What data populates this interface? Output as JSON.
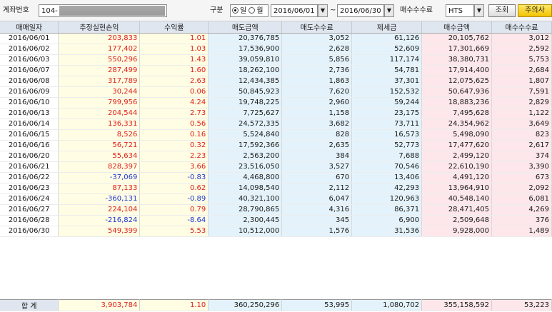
{
  "toolbar": {
    "account_label": "계좌번호",
    "account_value": "104-",
    "type_label": "구분",
    "radio_daily": "일",
    "radio_monthly": "월",
    "date_from": "2016/06/01",
    "date_tilde": "~",
    "date_to": "2016/06/30",
    "fee_label": "매수수수료",
    "fee_value": "HTS",
    "query_button": "조회",
    "notice_button": "주의사"
  },
  "table": {
    "headers": [
      "매매일자",
      "추정실현손익",
      "수익률",
      "매도금액",
      "매도수수료",
      "제세금",
      "매수금액",
      "매수수수료"
    ],
    "rows": [
      [
        "2016/06/01",
        "203,833",
        "1.01",
        "20,376,785",
        "3,052",
        "61,126",
        "20,105,762",
        "3,012"
      ],
      [
        "2016/06/02",
        "177,402",
        "1.03",
        "17,536,900",
        "2,628",
        "52,609",
        "17,301,669",
        "2,592"
      ],
      [
        "2016/06/03",
        "550,296",
        "1.43",
        "39,059,810",
        "5,856",
        "117,174",
        "38,380,731",
        "5,753"
      ],
      [
        "2016/06/07",
        "287,499",
        "1.60",
        "18,262,100",
        "2,736",
        "54,781",
        "17,914,400",
        "2,684"
      ],
      [
        "2016/06/08",
        "317,789",
        "2.63",
        "12,434,385",
        "1,863",
        "37,301",
        "12,075,625",
        "1,807"
      ],
      [
        "2016/06/09",
        "30,244",
        "0.06",
        "50,845,923",
        "7,620",
        "152,532",
        "50,647,936",
        "7,591"
      ],
      [
        "2016/06/10",
        "799,956",
        "4.24",
        "19,748,225",
        "2,960",
        "59,244",
        "18,883,236",
        "2,829"
      ],
      [
        "2016/06/13",
        "204,544",
        "2.73",
        "7,725,627",
        "1,158",
        "23,175",
        "7,495,628",
        "1,122"
      ],
      [
        "2016/06/14",
        "136,331",
        "0.56",
        "24,572,335",
        "3,682",
        "73,711",
        "24,354,962",
        "3,649"
      ],
      [
        "2016/06/15",
        "8,526",
        "0.16",
        "5,524,840",
        "828",
        "16,573",
        "5,498,090",
        "823"
      ],
      [
        "2016/06/16",
        "56,721",
        "0.32",
        "17,592,366",
        "2,635",
        "52,773",
        "17,477,620",
        "2,617"
      ],
      [
        "2016/06/20",
        "55,634",
        "2.23",
        "2,563,200",
        "384",
        "7,688",
        "2,499,120",
        "374"
      ],
      [
        "2016/06/21",
        "828,397",
        "3.66",
        "23,516,050",
        "3,527",
        "70,546",
        "22,610,190",
        "3,390"
      ],
      [
        "2016/06/22",
        "-37,069",
        "-0.83",
        "4,468,800",
        "670",
        "13,406",
        "4,491,120",
        "673"
      ],
      [
        "2016/06/23",
        "87,133",
        "0.62",
        "14,098,540",
        "2,112",
        "42,293",
        "13,964,910",
        "2,092"
      ],
      [
        "2016/06/24",
        "-360,131",
        "-0.89",
        "40,321,100",
        "6,047",
        "120,963",
        "40,548,140",
        "6,081"
      ],
      [
        "2016/06/27",
        "224,104",
        "0.79",
        "28,790,865",
        "4,316",
        "86,371",
        "28,471,405",
        "4,269"
      ],
      [
        "2016/06/28",
        "-216,824",
        "-8.64",
        "2,300,445",
        "345",
        "6,900",
        "2,509,648",
        "376"
      ],
      [
        "2016/06/30",
        "549,399",
        "5.53",
        "10,512,000",
        "1,576",
        "31,536",
        "9,928,000",
        "1,489"
      ]
    ],
    "totals": [
      "합 계",
      "3,903,784",
      "1.10",
      "360,250,296",
      "53,995",
      "1,080,702",
      "355,158,592",
      "53,223"
    ]
  },
  "colors": {
    "positive": "#e0201c",
    "negative": "#1d35d8",
    "header_bg": "#dfe6ef",
    "pnl_bg": "#fffde3",
    "sell_bg": "#e4f3fb",
    "buy_bg": "#fde7ea"
  }
}
